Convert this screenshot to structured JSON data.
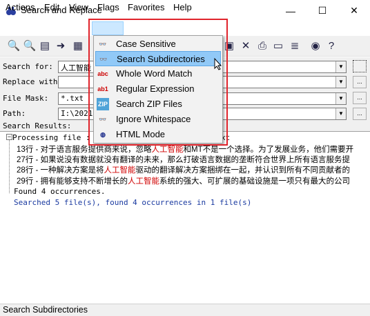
{
  "window": {
    "title": "Search and Replace",
    "minimize": "—",
    "maximize": "☐",
    "close": "✕"
  },
  "menu": [
    "Actions",
    "Edit",
    "View",
    "Flags",
    "Favorites",
    "Help"
  ],
  "form": {
    "search_label": "Search for:",
    "search_value": "人工智能",
    "replace_label": "Replace with:",
    "replace_value": "",
    "filemask_label": "File Mask:",
    "filemask_value": "*.txt",
    "path_label": "Path:",
    "path_value": "I:\\20210",
    "results_label": "Search Results:"
  },
  "flags_menu": [
    {
      "label": "Case Sensitive",
      "icon": "binoculars-icon"
    },
    {
      "label": "Search Subdirectories",
      "icon": "binoculars-icon"
    },
    {
      "label": "Whole Word Match",
      "icon": "abc-icon"
    },
    {
      "label": "Regular Expression",
      "icon": "regex-icon"
    },
    {
      "label": "Search ZIP Files",
      "icon": "zip-icon"
    },
    {
      "label": "Ignore Whitespace",
      "icon": "binoculars-icon"
    },
    {
      "label": "HTML Mode",
      "icon": "html-icon"
    }
  ],
  "results": {
    "processing": "Processing file : I",
    "processing_tail": "xt",
    "lines": [
      {
        "num": "13行",
        "pre": " - 对于语言服务提供商来说，忽略",
        "hit": "人工智能",
        "post": "和MT不是一个选择。为了发展业务，他们需要开"
      },
      {
        "num": "27行",
        "pre": " - 如果说没有数据就没有翻译的未来，那么打破语言数据的垄断符合世界上所有语言服务提",
        "hit": "",
        "post": ""
      },
      {
        "num": "28行",
        "pre": " - 一种解决方案是将",
        "hit": "人工智能",
        "post": "驱动的翻译解决方案捆绑在一起，并认识到所有不同贡献者的"
      },
      {
        "num": "29行",
        "pre": " - 拥有能够支持不断增长的",
        "hit": "人工智能",
        "post": "系统的强大、可扩展的基础设施是一项只有最大的公司"
      }
    ],
    "found": "Found 4 occurrences.",
    "summary": "Searched 5 file(s), found 4 occurrences in 1 file(s)"
  },
  "status": "Search Subdirectories",
  "colors": {
    "accent": "#e0232b",
    "hit": "#d00000",
    "summary": "#1a3aa0",
    "selection": "#91c9f7"
  }
}
